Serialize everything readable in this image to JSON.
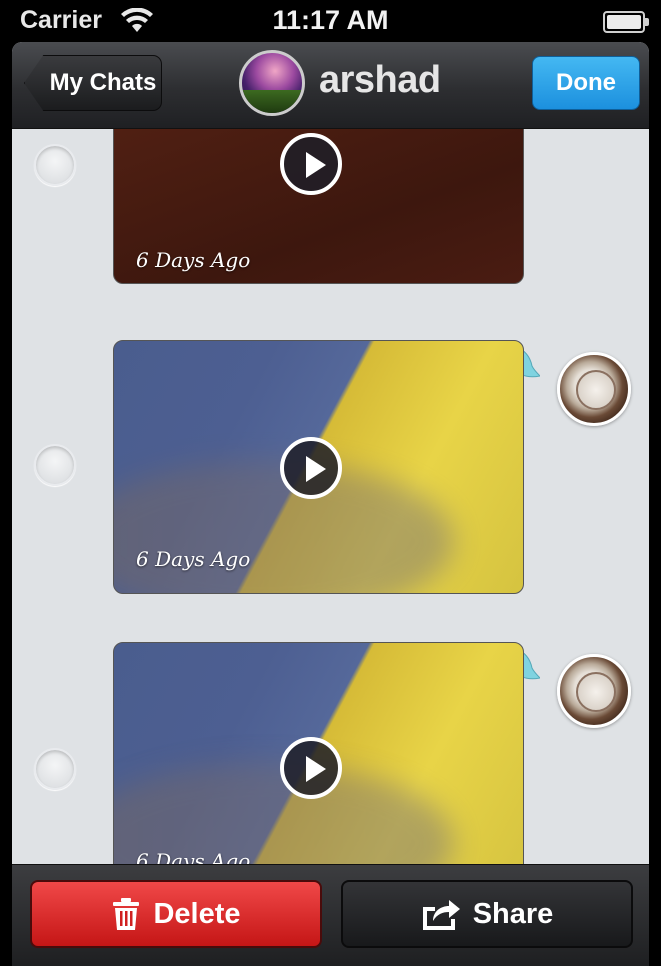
{
  "status_bar": {
    "carrier": "Carrier",
    "time": "11:17 AM"
  },
  "nav": {
    "back_label": "My Chats",
    "title": "arshad",
    "done_label": "Done"
  },
  "messages": [
    {
      "timestamp": "6 Days Ago",
      "thumbnail": "brown-video-thumbnail",
      "sender_avatar": false
    },
    {
      "timestamp": "6 Days Ago",
      "thumbnail": "yellow-blue-video-thumbnail",
      "sender_avatar": true
    },
    {
      "timestamp": "6 Days Ago",
      "thumbnail": "yellow-blue-video-thumbnail",
      "sender_avatar": true
    }
  ],
  "toolbar": {
    "delete_label": "Delete",
    "share_label": "Share"
  },
  "icons": {
    "back": "chevron-left-icon",
    "play": "play-icon",
    "delete": "trash-icon",
    "share": "share-icon",
    "wifi": "wifi-icon",
    "battery": "battery-icon"
  },
  "colors": {
    "done_blue": "#1c90de",
    "delete_red": "#d82020",
    "tail_cyan": "#7fd3e0"
  }
}
